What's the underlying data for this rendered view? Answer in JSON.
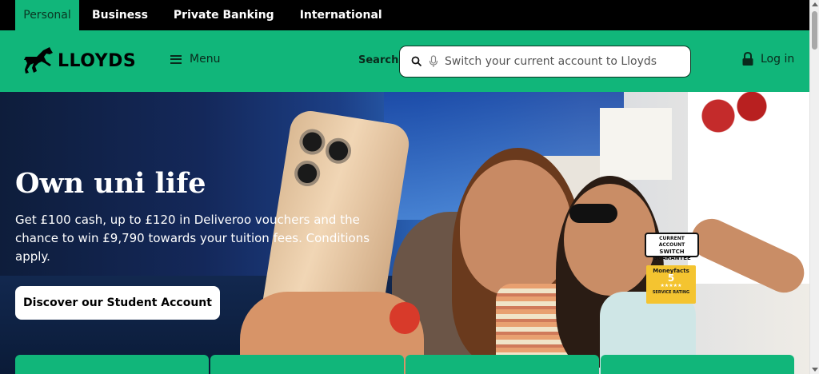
{
  "top_nav": {
    "tabs": [
      {
        "label": "Personal",
        "active": true
      },
      {
        "label": "Business",
        "active": false
      },
      {
        "label": "Private Banking",
        "active": false
      },
      {
        "label": "International",
        "active": false
      }
    ]
  },
  "header": {
    "logo_text": "LLOYDS",
    "logo_icon": "black-horse-icon",
    "menu_label": "Menu",
    "search_label": "Search",
    "search_placeholder": "Switch your current account to Lloyds",
    "login_label": "Log in"
  },
  "hero": {
    "title": "Own uni life",
    "body": "Get £100 cash, up to £120 in Deliveroo vouchers and the chance to win £9,790 towards your tuition fees. Conditions apply.",
    "cta_label": "Discover our Student Account",
    "badge_switch": {
      "line1": "CURRENT ACCOUNT",
      "line2": "SWITCH",
      "line3": "GUARANTEE"
    },
    "badge_moneyfacts": {
      "brand": "Moneyfacts",
      "rating": "5",
      "stars": "★★★★★",
      "caption": "SERVICE RATING"
    }
  },
  "colors": {
    "brand_green": "#11b67a",
    "topbar": "#000000"
  }
}
